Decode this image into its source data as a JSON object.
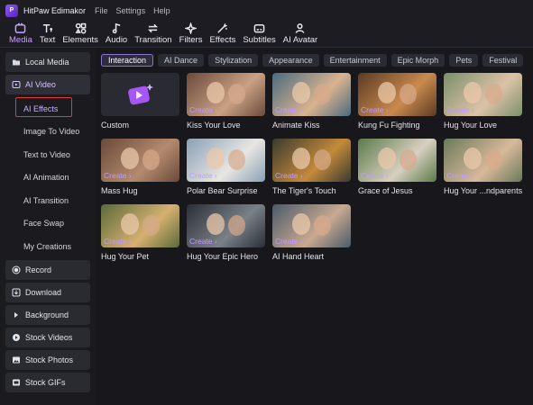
{
  "app": {
    "name": "HitPaw Edimakor",
    "logo_text": "P"
  },
  "menu": [
    "File",
    "Settings",
    "Help"
  ],
  "toolbar": [
    {
      "label": "Media",
      "icon": "media-icon",
      "active": true
    },
    {
      "label": "Text",
      "icon": "text-icon",
      "active": false
    },
    {
      "label": "Elements",
      "icon": "elements-icon",
      "active": false
    },
    {
      "label": "Audio",
      "icon": "audio-icon",
      "active": false
    },
    {
      "label": "Transition",
      "icon": "transition-icon",
      "active": false
    },
    {
      "label": "Filters",
      "icon": "filters-icon",
      "active": false
    },
    {
      "label": "Effects",
      "icon": "effects-icon",
      "active": false
    },
    {
      "label": "Subtitles",
      "icon": "subtitles-icon",
      "active": false
    },
    {
      "label": "AI Avatar",
      "icon": "ai-avatar-icon",
      "active": false
    }
  ],
  "sidebar": {
    "local_media": "Local Media",
    "ai_video": "AI Video",
    "sub_items": [
      "AI Effects",
      "Image To Video",
      "Text to Video",
      "AI Animation",
      "AI Transition",
      "Face Swap",
      "My Creations"
    ],
    "selected_sub": "AI Effects",
    "bottom": [
      {
        "label": "Record",
        "icon": "record-icon"
      },
      {
        "label": "Download",
        "icon": "download-icon"
      },
      {
        "label": "Background",
        "icon": "triangle-right-icon"
      },
      {
        "label": "Stock Videos",
        "icon": "stock-video-icon"
      },
      {
        "label": "Stock Photos",
        "icon": "stock-photo-icon"
      },
      {
        "label": "Stock GIFs",
        "icon": "stock-gif-icon"
      }
    ]
  },
  "categories": [
    "Interaction",
    "AI Dance",
    "Stylization",
    "Appearance",
    "Entertainment",
    "Epic Morph",
    "Pets",
    "Festival"
  ],
  "active_category": "Interaction",
  "create_label": "Create ›",
  "effects": [
    {
      "label": "Custom",
      "kind": "custom"
    },
    {
      "label": "Kiss Your Love",
      "kind": "photo",
      "bg": [
        "#6b4a3a",
        "#c9a184"
      ]
    },
    {
      "label": "Animate Kiss",
      "kind": "photo",
      "bg": [
        "#4a6a7e",
        "#d9b38f"
      ]
    },
    {
      "label": "Kung Fu Fighting",
      "kind": "photo",
      "bg": [
        "#5b3a22",
        "#c98a4e"
      ]
    },
    {
      "label": "Hug Your Love",
      "kind": "photo",
      "bg": [
        "#7a8f6b",
        "#dcc2a6"
      ]
    },
    {
      "label": "Mass Hug",
      "kind": "photo",
      "bg": [
        "#6a4a3a",
        "#b38a6e"
      ]
    },
    {
      "label": "Polar Bear Surprise",
      "kind": "photo",
      "bg": [
        "#8aa0b5",
        "#e8e6e2"
      ]
    },
    {
      "label": "The Tiger's Touch",
      "kind": "photo",
      "bg": [
        "#3a3a30",
        "#c48a3a"
      ]
    },
    {
      "label": "Grace of Jesus",
      "kind": "photo",
      "bg": [
        "#5a7a4a",
        "#d8d0c0"
      ]
    },
    {
      "label": "Hug Your ...ndparents",
      "kind": "photo",
      "bg": [
        "#6a7a5a",
        "#d8b89a"
      ]
    },
    {
      "label": "Hug Your Pet",
      "kind": "photo",
      "bg": [
        "#5a6a3a",
        "#d6b070"
      ]
    },
    {
      "label": "Hug Your Epic Hero",
      "kind": "photo",
      "bg": [
        "#2a2e36",
        "#7a8088"
      ]
    },
    {
      "label": "AI Hand Heart",
      "kind": "photo",
      "bg": [
        "#4a5a6a",
        "#c8a890"
      ]
    }
  ],
  "colors": {
    "accent": "#c49bff",
    "selection_outline": "#e53935"
  }
}
